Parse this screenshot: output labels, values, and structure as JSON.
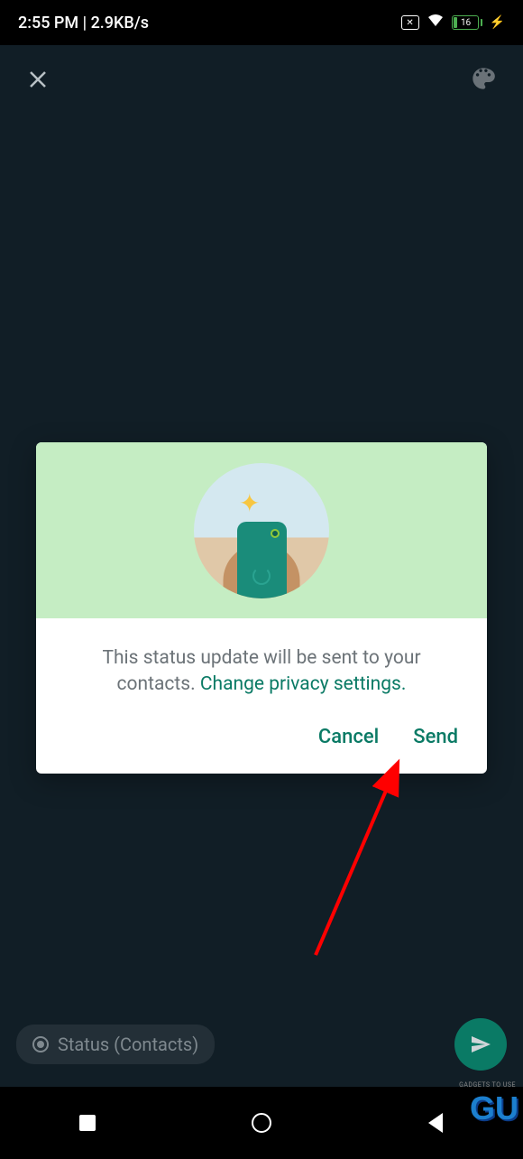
{
  "statusBar": {
    "time": "2:55 PM",
    "speed": "2.9KB/s",
    "batteryPercent": "16"
  },
  "dialog": {
    "message": "This status update will be sent to your contacts. ",
    "privacyLink": "Change privacy settings.",
    "cancelLabel": "Cancel",
    "sendLabel": "Send"
  },
  "bottomChip": {
    "label": "Status (Contacts)"
  },
  "watermark": {
    "main": "GU",
    "sub": "GADGETS TO USE"
  }
}
